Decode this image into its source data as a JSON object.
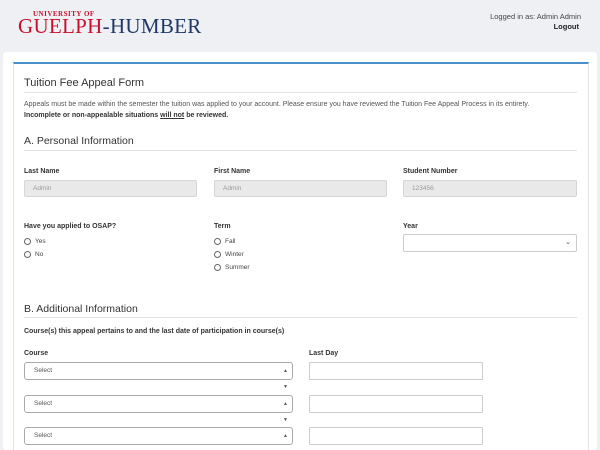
{
  "header": {
    "logo_top": "UNIVERSITY OF",
    "logo_part_a": "GUELPH",
    "logo_dash": "-",
    "logo_part_b": "HUMBER",
    "logged_in_as": "Logged in as: Admin Admin",
    "logout_label": "Logout"
  },
  "form": {
    "title": "Tuition Fee Appeal Form",
    "intro": "Appeals must be made within the semester the tuition was applied to your account. Please ensure you have reviewed the Tuition Fee Appeal Process in its entirety.",
    "warning_pre": "Incomplete or non-appealable situations ",
    "warning_underline": "will not",
    "warning_post": " be reviewed."
  },
  "personal": {
    "heading": "A. Personal Information",
    "last_name_label": "Last Name",
    "last_name_value": "Admin",
    "first_name_label": "First Name",
    "first_name_value": "Admin",
    "student_number_label": "Student Number",
    "student_number_value": "123456",
    "osap_label": "Have you applied to OSAP?",
    "osap_yes": "Yes",
    "osap_no": "No",
    "term_label": "Term",
    "term_fall": "Fall",
    "term_winter": "Winter",
    "term_summer": "Summer",
    "year_label": "Year",
    "year_value": ""
  },
  "additional": {
    "heading": "B. Additional Information",
    "courses_caption": "Course(s) this appeal pertains to and the last date of participation in course(s)",
    "course_label": "Course",
    "last_day_label": "Last Day",
    "course_rows": [
      {
        "select": "Select",
        "last_day": ""
      },
      {
        "select": "Select",
        "last_day": ""
      },
      {
        "select": "Select",
        "last_day": ""
      }
    ]
  }
}
